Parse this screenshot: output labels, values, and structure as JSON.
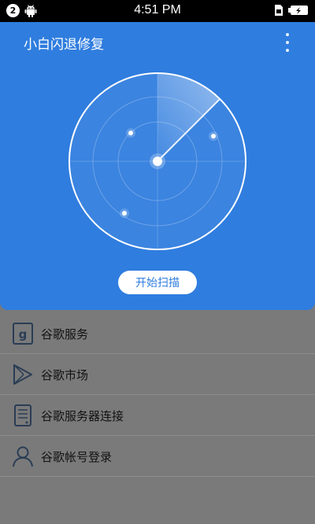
{
  "status_bar": {
    "notification_count": "2",
    "time": "4:51 PM",
    "icons": [
      "notification-badge",
      "android-icon",
      "sim-card-icon",
      "battery-icon"
    ]
  },
  "header": {
    "title": "小白闪退修复",
    "menu_icon": "overflow-menu-icon"
  },
  "radar": {
    "icon": "radar-scanner-icon"
  },
  "scan_button": {
    "label": "开始扫描"
  },
  "menu": {
    "items": [
      {
        "label": "谷歌服务",
        "icon": "google-services-icon"
      },
      {
        "label": "谷歌市场",
        "icon": "play-store-icon"
      },
      {
        "label": "谷歌服务器连接",
        "icon": "server-connection-icon"
      },
      {
        "label": "谷歌帐号登录",
        "icon": "account-icon"
      }
    ]
  },
  "colors": {
    "primary": "#2f7ddf",
    "overlay_gray": "#7a7a7a",
    "status_bar": "#000000"
  }
}
